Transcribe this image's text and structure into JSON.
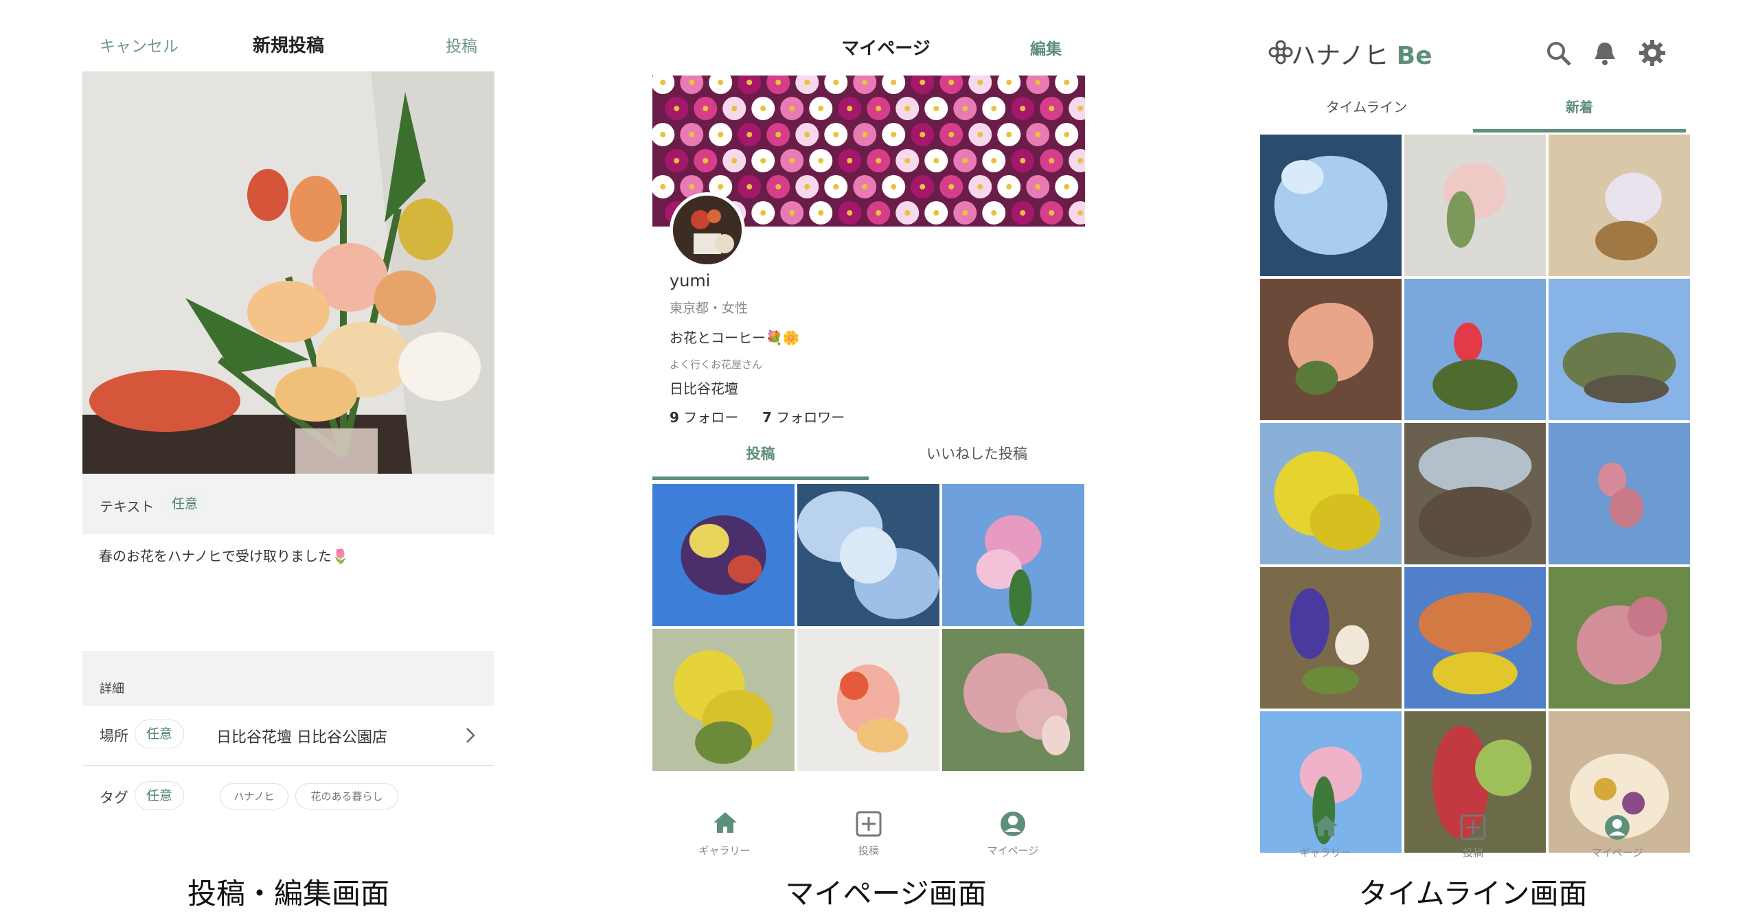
{
  "colors": {
    "accent": "#5e8f79",
    "accent_light": "#eef3ef",
    "gray_band": "#f2f2f2"
  },
  "post_screen": {
    "cancel": "キャンセル",
    "title": "新規投稿",
    "post": "投稿",
    "text_label": "テキスト",
    "optional": "任意",
    "body_text": "春のお花をハナノヒで受け取りました🌷",
    "details_label": "詳細",
    "location_label": "場所",
    "location_value": "日比谷花壇 日比谷公園店",
    "tag_label": "タグ",
    "tags": [
      "ハナノヒ",
      "花のある暮らし"
    ],
    "caption": "投稿・編集画面"
  },
  "mypage_screen": {
    "title": "マイページ",
    "edit": "編集",
    "username": "yumi",
    "meta": "東京都・女性",
    "bio": "お花とコーヒー💐🌼",
    "fav_shop_label": "よく行くお花屋さん",
    "fav_shop": "日比谷花壇",
    "follow_count": "9",
    "follow_label": "フォロー",
    "follower_count": "7",
    "follower_label": "フォロワー",
    "tab_posts": "投稿",
    "tab_liked": "いいねした投稿",
    "caption": "マイページ画面"
  },
  "timeline_screen": {
    "logo_text": "ハナノヒ",
    "logo_be": "Be",
    "tab_timeline": "タイムライン",
    "tab_new": "新着",
    "caption": "タイムライン画面"
  },
  "nav": {
    "gallery": "ギャラリー",
    "post": "投稿",
    "mypage": "マイページ"
  },
  "icons": {
    "search": "search-icon",
    "bell": "bell-icon",
    "settings": "gear-icon",
    "home": "home-icon",
    "add": "plus-square-icon",
    "user": "user-circle-icon",
    "chevron": "chevron-right-icon"
  }
}
